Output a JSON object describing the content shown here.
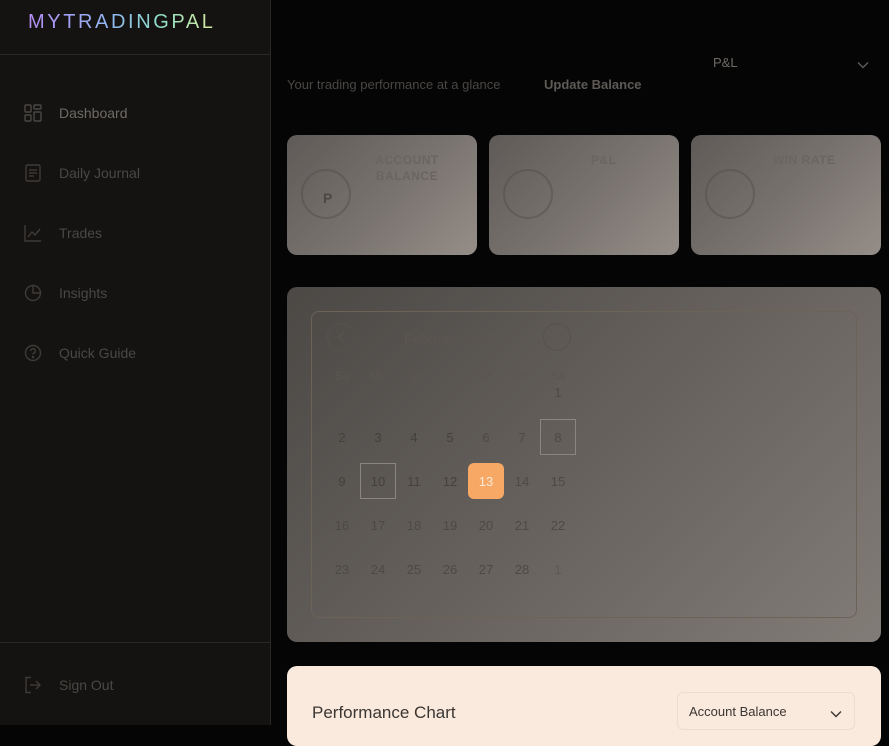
{
  "app": {
    "logo": "MYTRADINGPAL"
  },
  "sidebar": {
    "items": [
      {
        "label": "Dashboard",
        "icon": "dashboard-grid-icon"
      },
      {
        "label": "Daily Journal",
        "icon": "journal-icon"
      },
      {
        "label": "Trades",
        "icon": "line-chart-icon"
      },
      {
        "label": "Insights",
        "icon": "pie-chart-icon"
      },
      {
        "label": "Quick Guide",
        "icon": "help-circle-icon"
      }
    ],
    "sign_out": {
      "label": "Sign Out",
      "icon": "sign-out-icon"
    }
  },
  "header": {
    "subtitle": "Your trading performance at a glance",
    "update_balance": "Update Balance",
    "pnl_select": "P&L"
  },
  "cards": [
    {
      "title_line1": "ACCOUNT",
      "title_line2": "BALANCE",
      "symbol": "P"
    },
    {
      "title_line1": "P&L",
      "title_line2": ""
    },
    {
      "title_line1": "WIN RATE",
      "title_line2": ""
    }
  ],
  "calendar": {
    "month": "February 2025",
    "weekdays": [
      "Su",
      "Mo",
      "Tu",
      "We",
      "Th",
      "Fr",
      "Sa"
    ],
    "weeks": [
      [
        "",
        "",
        "",
        "",
        "",
        "",
        "1"
      ],
      [
        "2",
        "3",
        "4",
        "5",
        "6",
        "7",
        "8"
      ],
      [
        "9",
        "10",
        "11",
        "12",
        "13",
        "14",
        "15"
      ],
      [
        "16",
        "17",
        "18",
        "19",
        "20",
        "21",
        "22"
      ],
      [
        "23",
        "24",
        "25",
        "26",
        "27",
        "28",
        "1"
      ]
    ],
    "today": "13",
    "boxed": [
      "8",
      "10"
    ]
  },
  "performance": {
    "title": "Performance Chart",
    "select": "Account Balance"
  },
  "colors": {
    "accent_today": "#f6a864",
    "sidebar_bg": "#141312",
    "page_bg": "#050505",
    "perf_card_bg": "#faeadd"
  }
}
